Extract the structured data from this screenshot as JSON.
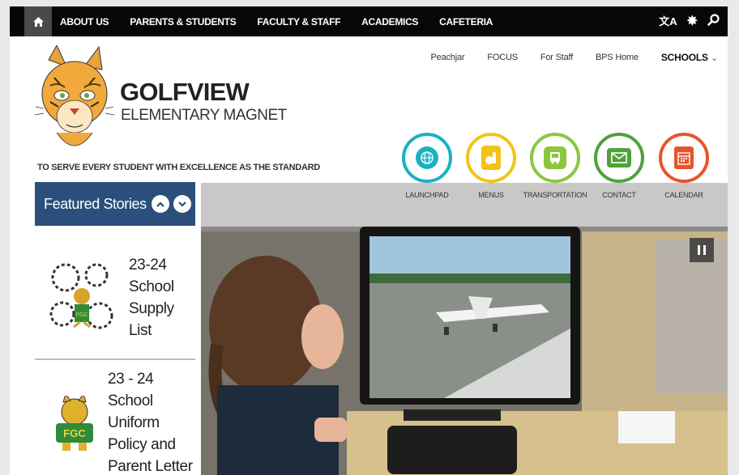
{
  "topnav": {
    "home_icon": "home-icon",
    "links": [
      "ABOUT US",
      "PARENTS & STUDENTS",
      "FACULTY & STAFF",
      "ACADEMICS",
      "CAFETERIA"
    ],
    "tools": {
      "translate_icon": "translate-icon",
      "settings_icon": "gear-icon",
      "search_icon": "search-icon",
      "translate_glyph": "文A",
      "settings_glyph": "✸",
      "search_glyph": "⚲"
    }
  },
  "utility": {
    "links": [
      "Peachjar",
      "FOCUS",
      "For Staff",
      "BPS Home"
    ],
    "schools_label": "SCHOOLS",
    "schools_chevron": "⌄"
  },
  "header": {
    "school_name": "GOLFVIEW",
    "school_subtitle": "ELEMENTARY MAGNET",
    "motto": "TO SERVE EVERY STUDENT WITH EXCELLENCE AS THE STANDARD"
  },
  "quicklinks": [
    {
      "label": "LAUNCHPAD",
      "icon": "globe-icon",
      "color": "#1ab1c4"
    },
    {
      "label": "MENUS",
      "icon": "apple-icon",
      "color": "#f2c318"
    },
    {
      "label": "TRANSPORTATION",
      "icon": "bus-icon",
      "color": "#8cc63f"
    },
    {
      "label": "CONTACT",
      "icon": "envelope-icon",
      "color": "#4ea23a"
    },
    {
      "label": "CALENDAR",
      "icon": "calendar-icon",
      "color": "#e8542b"
    }
  ],
  "featured": {
    "title": "Featured Stories",
    "stories": [
      {
        "lines": [
          "23-24",
          "School",
          "Supply",
          "List"
        ]
      },
      {
        "lines": [
          "23 - 24",
          "School",
          "Uniform",
          "Policy and",
          "Parent Letter"
        ]
      }
    ]
  },
  "colors": {
    "nav_bg": "#070707",
    "featured_bg": "#2a4f7c"
  }
}
